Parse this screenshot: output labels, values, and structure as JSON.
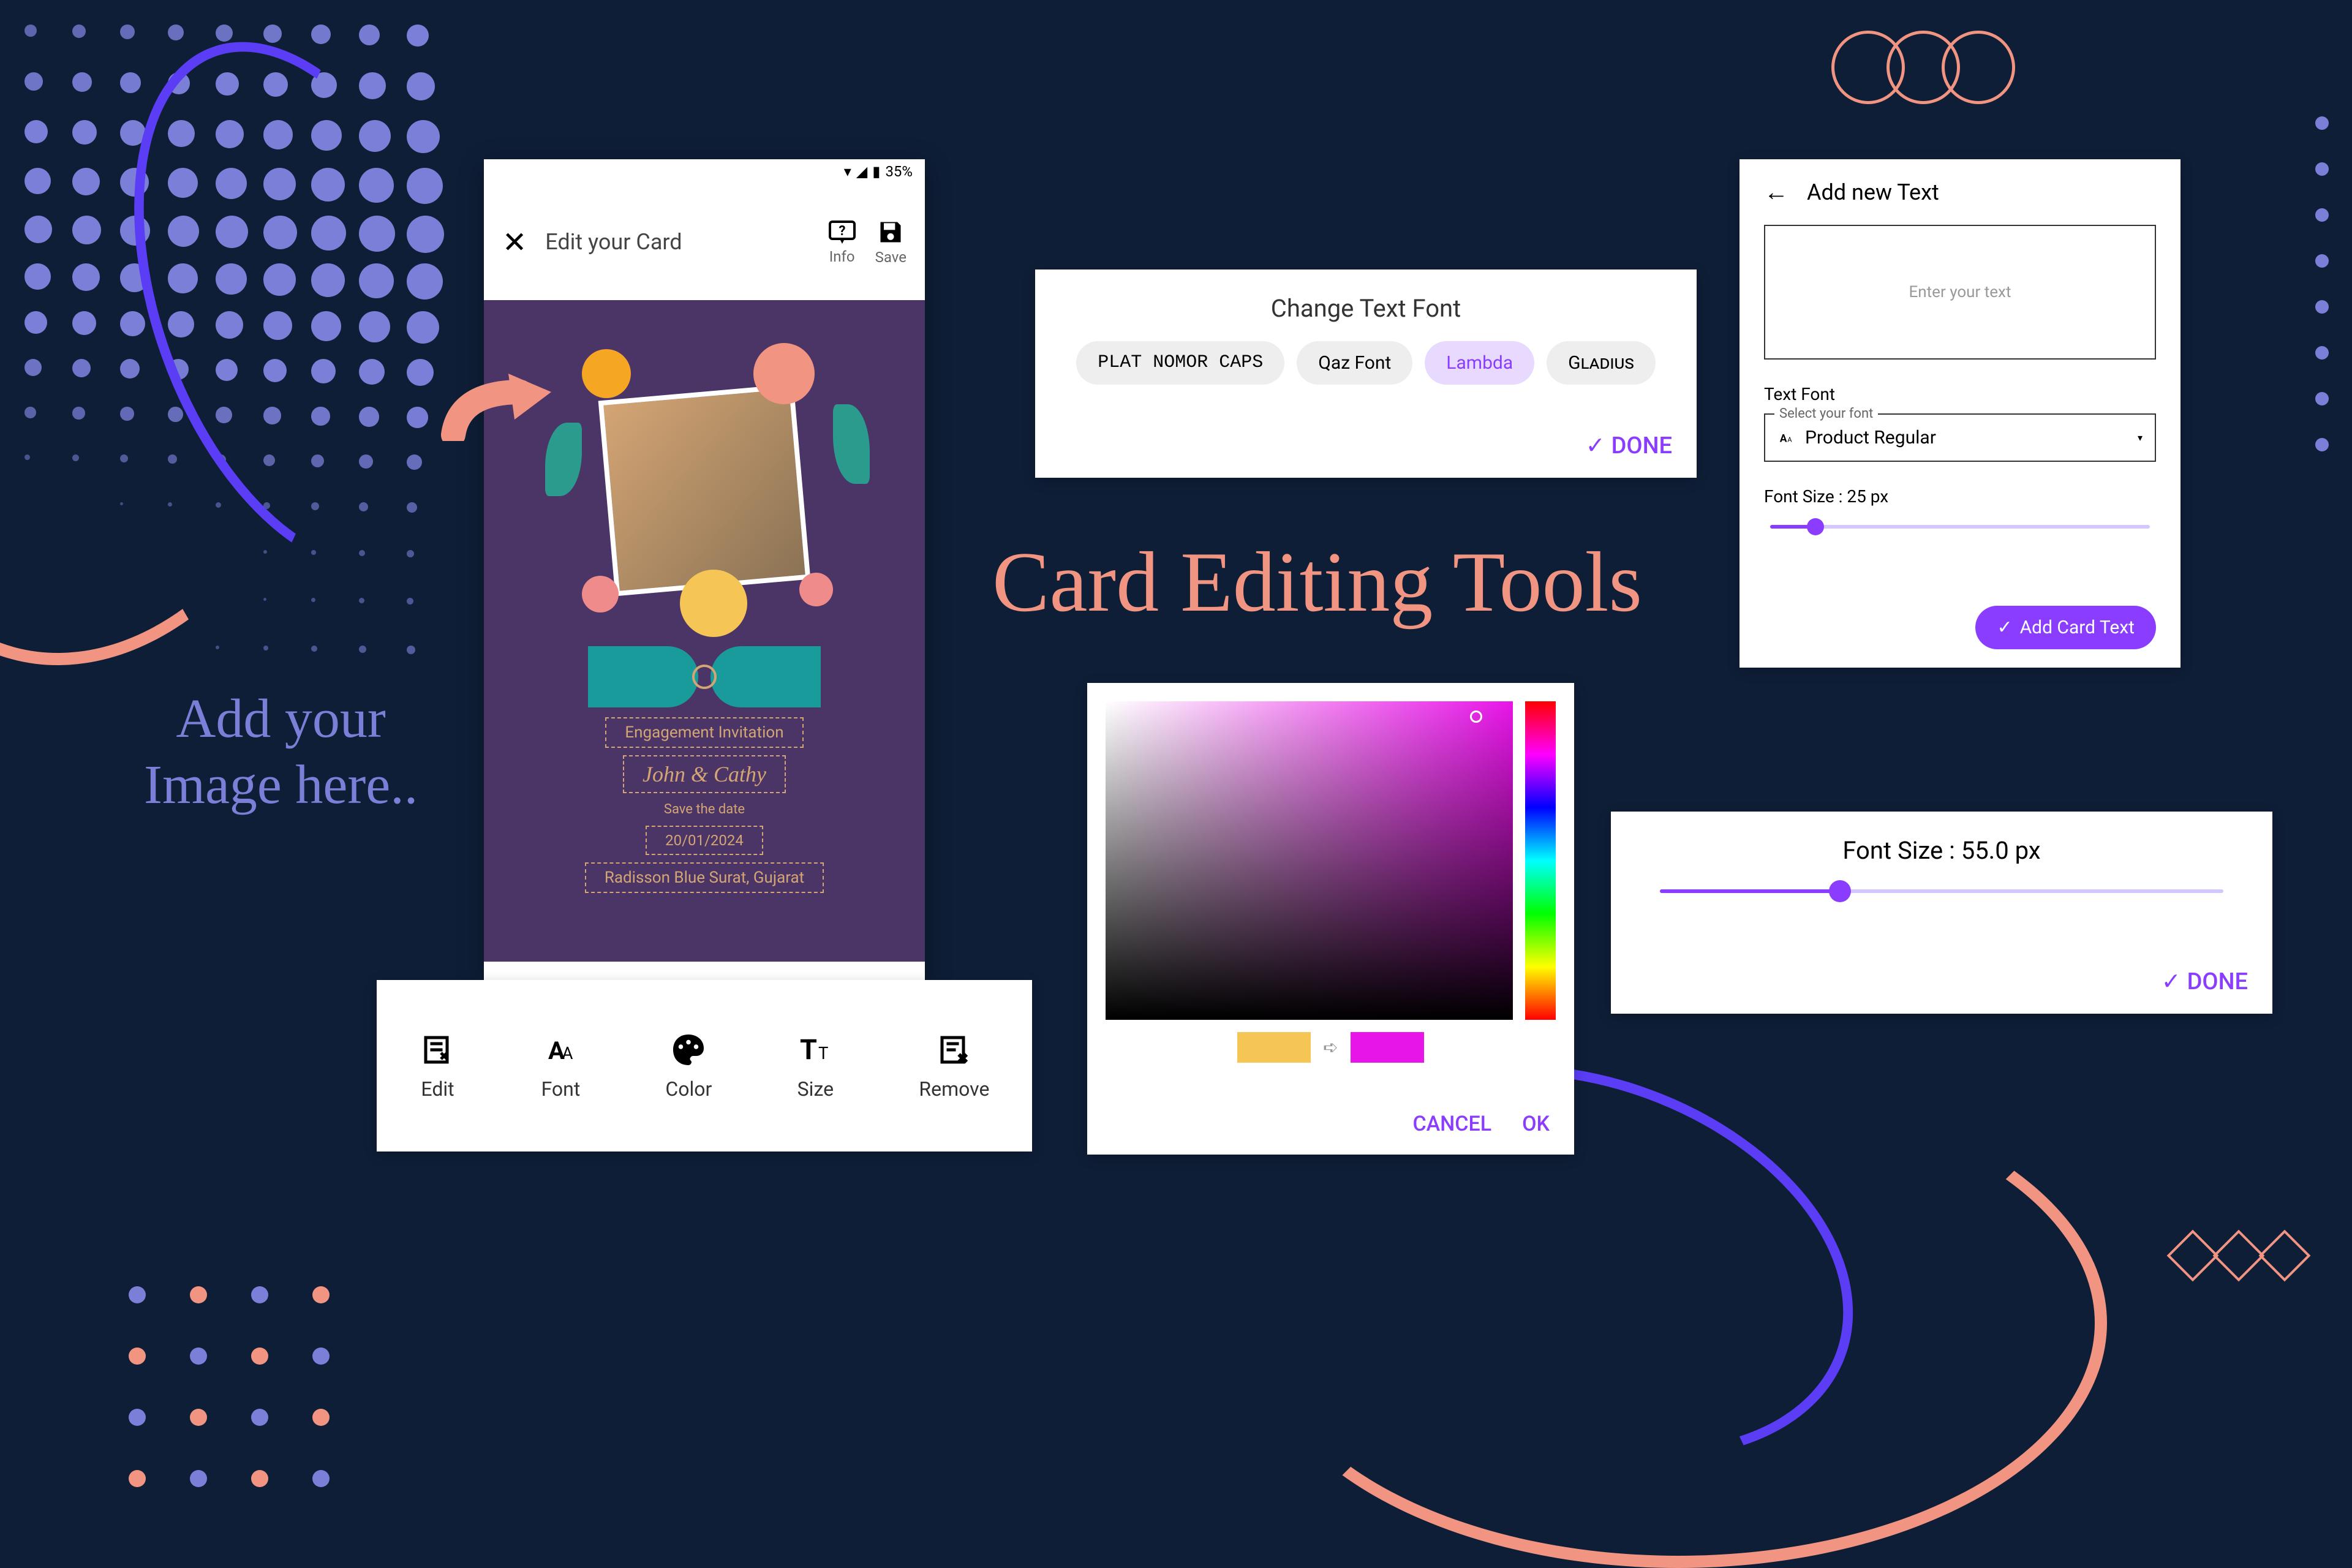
{
  "statusBar": {
    "battery": "35%"
  },
  "phoneHeader": {
    "title": "Edit your Card",
    "info": "Info",
    "save": "Save"
  },
  "card": {
    "line1": "Engagement Invitation",
    "names": "John & Cathy",
    "line2": "Save the date",
    "date": "20/01/2024",
    "venue": "Radisson Blue Surat, Gujarat"
  },
  "toolbar": {
    "edit": "Edit",
    "font": "Font",
    "color": "Color",
    "size": "Size",
    "remove": "Remove"
  },
  "sideText": "Add your\nImage here..",
  "mainTitle": "Card Editing Tools",
  "fontPanel": {
    "title": "Change Text Font",
    "options": [
      "PLAT NOMOR CAPS",
      "Qaz Font",
      "Lambda",
      "Gladius"
    ],
    "selectedIndex": 2,
    "done": "DONE"
  },
  "colorPanel": {
    "cancel": "CANCEL",
    "ok": "OK",
    "oldColor": "#f5c555",
    "newColor": "#e815e8"
  },
  "addTextPanel": {
    "title": "Add new Text",
    "placeholder": "Enter your text",
    "fontLabel": "Text Font",
    "selectLabel": "Select your font",
    "selectedFont": "Product Regular",
    "sizeLabel": "Font Size : 25 px",
    "sizeValue": 25,
    "button": "Add Card Text"
  },
  "sizePanel": {
    "title": "Font Size : 55.0 px",
    "value": 55,
    "done": "DONE"
  }
}
